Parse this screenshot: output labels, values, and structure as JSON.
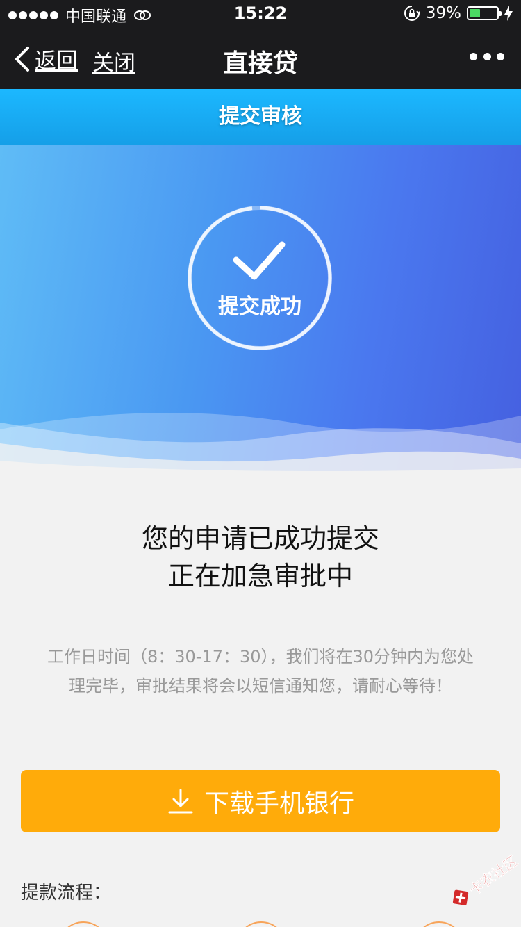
{
  "status_bar": {
    "carrier": "中国联通",
    "time": "15:22",
    "battery_percent": "39%",
    "battery_level": 0.39
  },
  "nav": {
    "back_label": "返回",
    "close_label": "关闭",
    "title": "直接贷"
  },
  "sub_header": {
    "title": "提交审核"
  },
  "hero": {
    "success_label": "提交成功"
  },
  "message": {
    "line1": "您的申请已成功提交",
    "line2": "正在加急审批中",
    "detail": "工作日时间（8：30-17：30），我们将在30分钟内为您处理完毕，审批结果将会以短信通知您，请耐心等待！"
  },
  "download": {
    "label": "下载手机银行"
  },
  "process": {
    "label": "提款流程："
  },
  "watermark": {
    "text": "卡农社区"
  },
  "colors": {
    "nav_bg": "#1b1b1d",
    "header_blue": "#1cb8ff",
    "button_orange": "#ffab0a",
    "page_bg": "#f2f2f2"
  }
}
